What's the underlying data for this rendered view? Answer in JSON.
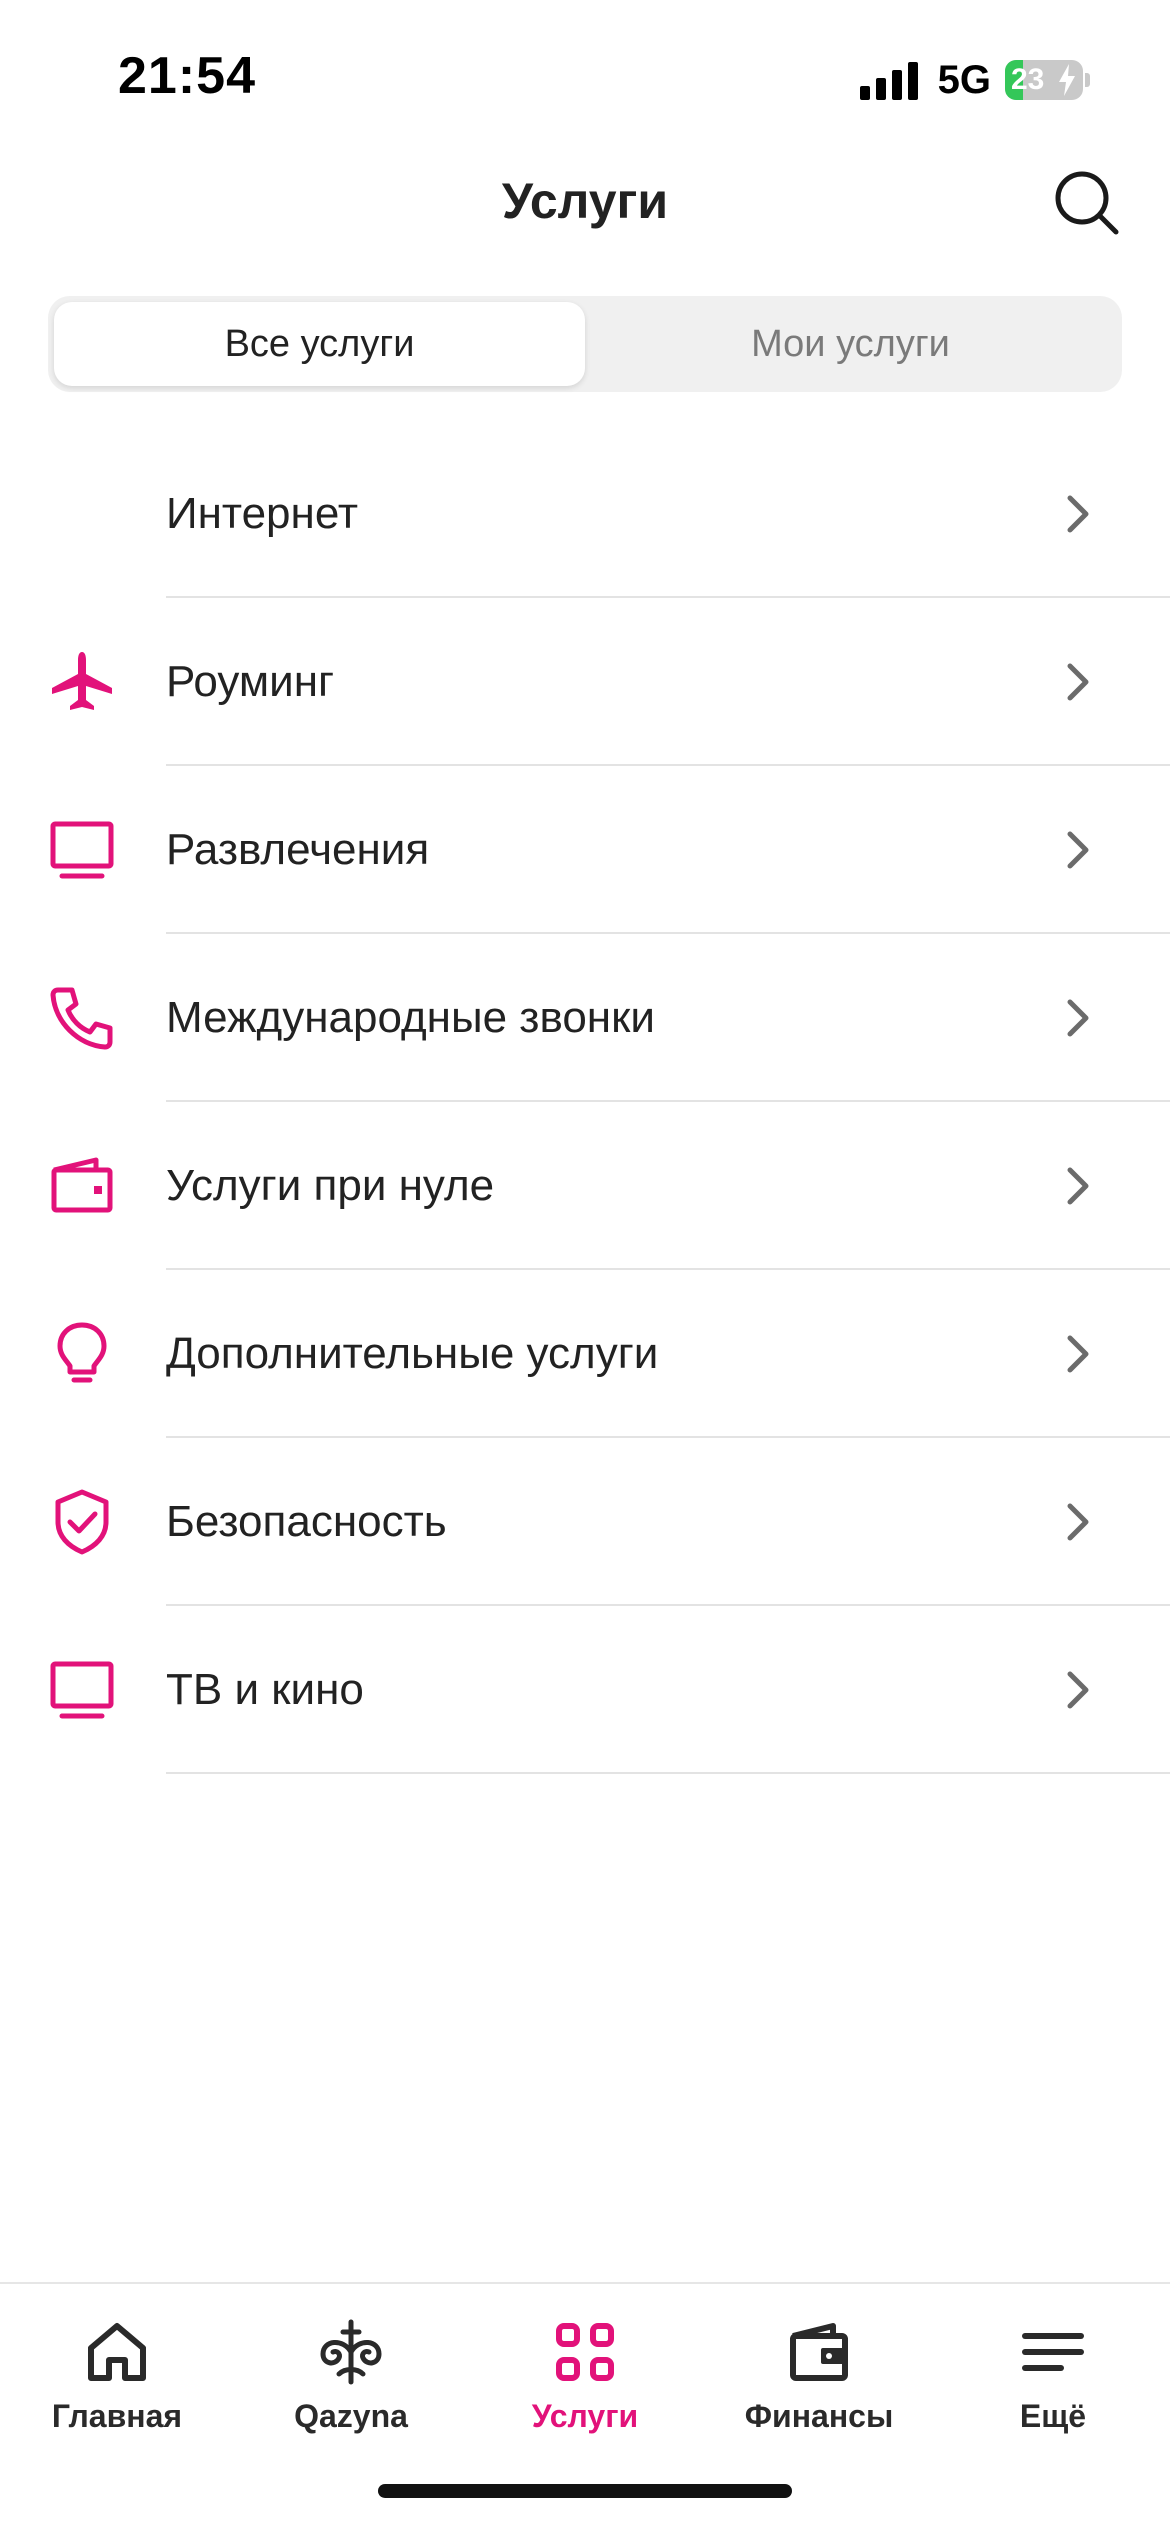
{
  "status_bar": {
    "time": "21:54",
    "network": "5G",
    "battery_level": "23",
    "battery_fraction": 0.23
  },
  "header": {
    "title": "Услуги",
    "search_icon": "search-icon"
  },
  "segmented": {
    "tabs": [
      {
        "label": "Все услуги",
        "active": true
      },
      {
        "label": "Мои услуги",
        "active": false
      }
    ]
  },
  "services": [
    {
      "label": "Интернет",
      "icon": "none"
    },
    {
      "label": "Роуминг",
      "icon": "airplane-icon"
    },
    {
      "label": "Развлечения",
      "icon": "monitor-icon"
    },
    {
      "label": "Международные звонки",
      "icon": "phone-icon"
    },
    {
      "label": "Услуги при нуле",
      "icon": "wallet-icon"
    },
    {
      "label": "Дополнительные услуги",
      "icon": "lightbulb-icon"
    },
    {
      "label": "Безопасность",
      "icon": "shield-check-icon"
    },
    {
      "label": "ТВ и кино",
      "icon": "monitor-icon"
    }
  ],
  "bottom_nav": {
    "items": [
      {
        "label": "Главная",
        "icon": "home-icon",
        "active": false
      },
      {
        "label": "Qazyna",
        "icon": "qazyna-icon",
        "active": false
      },
      {
        "label": "Услуги",
        "icon": "grid-icon",
        "active": true
      },
      {
        "label": "Финансы",
        "icon": "wallet-icon",
        "active": false
      },
      {
        "label": "Ещё",
        "icon": "menu-icon",
        "active": false
      }
    ]
  },
  "colors": {
    "accent": "#e2127a",
    "text": "#222222",
    "muted": "#7a7a7a",
    "divider": "#e3e3e3"
  }
}
